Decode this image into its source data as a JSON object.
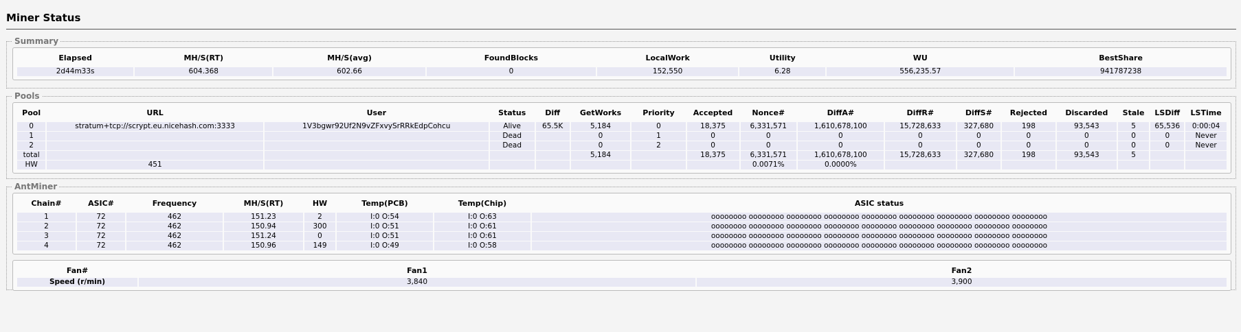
{
  "page_title": "Miner Status",
  "summary": {
    "legend": "Summary",
    "headers": [
      "Elapsed",
      "MH/S(RT)",
      "MH/S(avg)",
      "FoundBlocks",
      "LocalWork",
      "Utility",
      "WU",
      "BestShare"
    ],
    "values": [
      "2d44m33s",
      "604.368",
      "602.66",
      "0",
      "152,550",
      "6.28",
      "556,235.57",
      "941787238"
    ]
  },
  "pools": {
    "legend": "Pools",
    "headers": [
      "Pool",
      "URL",
      "User",
      "Status",
      "Diff",
      "GetWorks",
      "Priority",
      "Accepted",
      "Nonce#",
      "DiffA#",
      "DiffR#",
      "DiffS#",
      "Rejected",
      "Discarded",
      "Stale",
      "LSDiff",
      "LSTime"
    ],
    "rows": [
      [
        "0",
        "stratum+tcp://scrypt.eu.nicehash.com:3333",
        "1V3bgwr92Uf2N9vZFxvySrRRkEdpCohcu",
        "Alive",
        "65.5K",
        "5,184",
        "0",
        "18,375",
        "6,331,571",
        "1,610,678,100",
        "15,728,633",
        "327,680",
        "198",
        "93,543",
        "5",
        "65,536",
        "0:00:04"
      ],
      [
        "1",
        "",
        "",
        "Dead",
        "",
        "0",
        "1",
        "0",
        "0",
        "0",
        "0",
        "0",
        "0",
        "0",
        "0",
        "0",
        "Never"
      ],
      [
        "2",
        "",
        "",
        "Dead",
        "",
        "0",
        "2",
        "0",
        "0",
        "0",
        "0",
        "0",
        "0",
        "0",
        "0",
        "0",
        "Never"
      ],
      [
        "total",
        "",
        "",
        "",
        "",
        "5,184",
        "",
        "18,375",
        "6,331,571",
        "1,610,678,100",
        "15,728,633",
        "327,680",
        "198",
        "93,543",
        "5",
        "",
        ""
      ],
      [
        "HW",
        "451",
        "",
        "",
        "",
        "",
        "",
        "",
        "0.0071%",
        "0.0000%",
        "",
        "",
        "",
        "",
        "",
        "",
        ""
      ]
    ]
  },
  "antminer": {
    "legend": "AntMiner",
    "headers": [
      "Chain#",
      "ASIC#",
      "Frequency",
      "MH/S(RT)",
      "HW",
      "Temp(PCB)",
      "Temp(Chip)",
      "ASIC status"
    ],
    "rows": [
      [
        "1",
        "72",
        "462",
        "151.23",
        "2",
        "I:0 O:54",
        "I:0 O:63",
        "oooooooo oooooooo oooooooo oooooooo oooooooo oooooooo oooooooo oooooooo oooooooo"
      ],
      [
        "2",
        "72",
        "462",
        "150.94",
        "300",
        "I:0 O:51",
        "I:0 O:61",
        "oooooooo oooooooo oooooooo oooooooo oooooooo oooooooo oooooooo oooooooo oooooooo"
      ],
      [
        "3",
        "72",
        "462",
        "151.24",
        "0",
        "I:0 O:51",
        "I:0 O:61",
        "oooooooo oooooooo oooooooo oooooooo oooooooo oooooooo oooooooo oooooooo oooooooo"
      ],
      [
        "4",
        "72",
        "462",
        "150.96",
        "149",
        "I:0 O:49",
        "I:0 O:58",
        "oooooooo oooooooo oooooooo oooooooo oooooooo oooooooo oooooooo oooooooo oooooooo"
      ]
    ],
    "fan": {
      "headers": [
        "Fan#",
        "Fan1",
        "Fan2"
      ],
      "row": [
        "Speed (r/min)",
        "3,840",
        "3,900"
      ]
    }
  }
}
